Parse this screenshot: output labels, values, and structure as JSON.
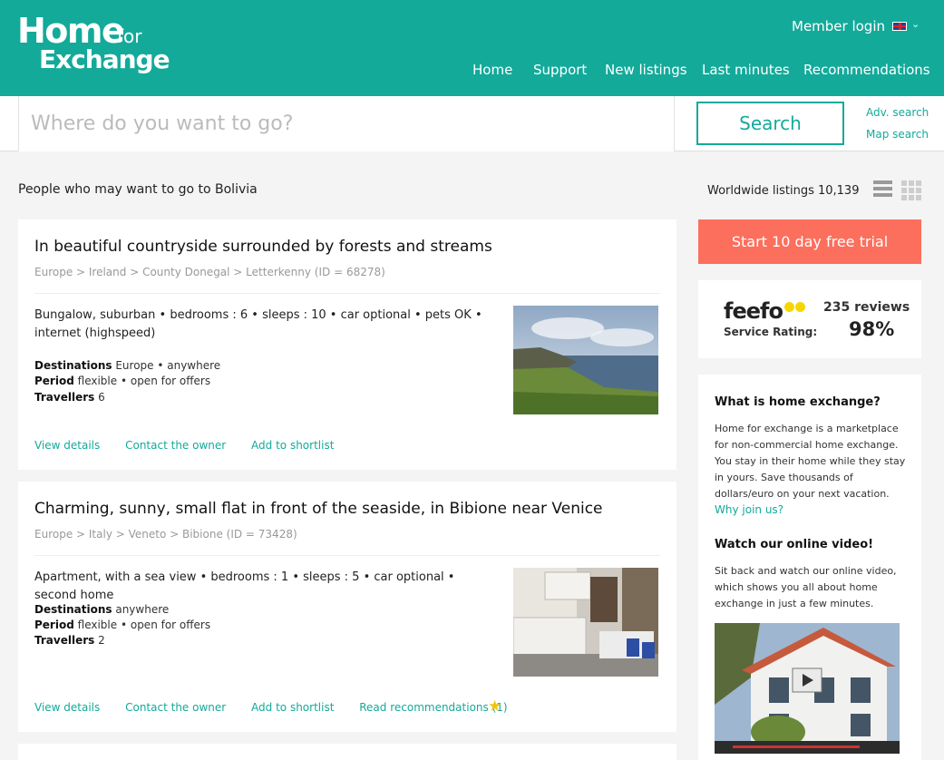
{
  "header": {
    "logo_home": "Home",
    "logo_for": "for",
    "logo_exchange": "Exchange",
    "member_login": "Member login",
    "nav": [
      "Home",
      "Support",
      "New listings",
      "Last minutes",
      "Recommendations"
    ]
  },
  "search": {
    "placeholder": "Where do you want to go?",
    "button": "Search",
    "adv": "Adv. search",
    "map": "Map search"
  },
  "main": {
    "people_text": "People who may want to go to Bolivia",
    "worldwide": "Worldwide listings 10,139"
  },
  "listings": [
    {
      "title": "In beautiful countryside surrounded by forests and streams",
      "location": "Europe > Ireland > County Donegal > Letterkenny (ID = 68278)",
      "desc": "Bungalow, suburban • bedrooms : 6 • sleeps : 10 • car optional • pets OK • internet (highspeed)",
      "destinations_label": "Destinations",
      "destinations": "Europe • anywhere",
      "period_label": "Period",
      "period": "flexible • open for offers",
      "travellers_label": "Travellers",
      "travellers": "6",
      "links": [
        "View details",
        "Contact the owner",
        "Add to shortlist"
      ]
    },
    {
      "title": "Charming, sunny, small flat in front of the seaside, in Bibione near Venice",
      "location": "Europe > Italy > Veneto > Bibione (ID = 73428)",
      "desc": "Apartment, with a sea view • bedrooms : 1 • sleeps : 5 • car optional • second home",
      "destinations_label": "Destinations",
      "destinations": "anywhere",
      "period_label": "Period",
      "period": "flexible • open for offers",
      "travellers_label": "Travellers",
      "travellers": "2",
      "links": [
        "View details",
        "Contact the owner",
        "Add to shortlist",
        "Read recommendations (1)"
      ]
    }
  ],
  "sidebar": {
    "trial": "Start 10 day free trial",
    "feefo_logo": "feefo",
    "feefo_rating": "Service Rating:",
    "feefo_reviews": "235 reviews",
    "feefo_pct": "98%",
    "what_title": "What is home exchange?",
    "what_text": "Home for exchange is a marketplace for non-commercial home exchange. You stay in their home while they stay in yours. Save thousands of dollars/euro on your next vacation.",
    "why": "Why join us?",
    "video_title": "Watch our online video!",
    "video_text": "Sit back and watch our online video, which shows you all about home exchange in just a few minutes."
  },
  "colors": {
    "brand": "#13aa9a",
    "trial": "#fc6f5d",
    "star": "#f1c40f"
  }
}
